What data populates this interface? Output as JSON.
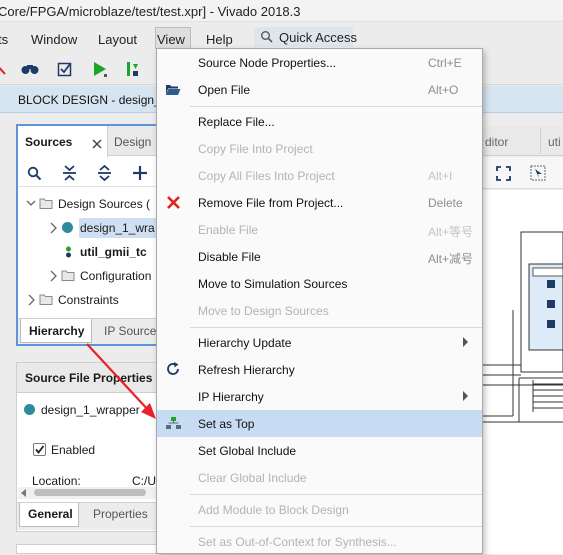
{
  "window": {
    "title": "Core/FPGA/microblaze/test/test.xpr] - Vivado 2018.3"
  },
  "menubar": {
    "items": [
      {
        "label": "ts"
      },
      {
        "label": "Window"
      },
      {
        "label": "Layout"
      },
      {
        "label": "View"
      },
      {
        "label": "Help"
      }
    ],
    "quick_access": "Quick Access"
  },
  "block_design": {
    "title": "BLOCK DESIGN - design_"
  },
  "sources": {
    "tab_active": "Sources",
    "tab_other": "Design",
    "tree": {
      "design_sources": "Design Sources (",
      "design_wrapper": "design_1_wra",
      "util_gmii": "util_gmii_tc",
      "configuration": "Configuration",
      "constraints": "Constraints"
    },
    "bottom_tabs": {
      "hierarchy": "Hierarchy",
      "ip_sources": "IP Source"
    }
  },
  "source_file_properties": {
    "title": "Source File Properties",
    "file": "design_1_wrapper",
    "enabled_label": "Enabled",
    "enabled": true,
    "location_label": "Location:",
    "location_value": "C:/U",
    "tabs": {
      "general": "General",
      "properties": "Properties"
    }
  },
  "right_panel": {
    "tab1": "ditor",
    "tab2": "uti"
  },
  "context_menu": {
    "items": [
      {
        "label": "Source Node Properties...",
        "shortcut": "Ctrl+E",
        "enabled": true
      },
      {
        "label": "Open File",
        "shortcut": "Alt+O",
        "enabled": true
      },
      {
        "label": "Replace File...",
        "shortcut": "",
        "enabled": true
      },
      {
        "label": "Copy File Into Project",
        "shortcut": "",
        "enabled": false
      },
      {
        "label": "Copy All Files Into Project",
        "shortcut": "Alt+I",
        "enabled": false
      },
      {
        "label": "Remove File from Project...",
        "shortcut": "Delete",
        "enabled": true
      },
      {
        "label": "Enable File",
        "shortcut": "Alt+等号",
        "enabled": false
      },
      {
        "label": "Disable File",
        "shortcut": "Alt+减号",
        "enabled": true
      },
      {
        "label": "Move to Simulation Sources",
        "shortcut": "",
        "enabled": true
      },
      {
        "label": "Move to Design Sources",
        "shortcut": "",
        "enabled": false
      },
      {
        "label": "Hierarchy Update",
        "shortcut": "",
        "enabled": true,
        "submenu": true
      },
      {
        "label": "Refresh Hierarchy",
        "shortcut": "",
        "enabled": true
      },
      {
        "label": "IP Hierarchy",
        "shortcut": "",
        "enabled": true,
        "submenu": true
      },
      {
        "label": "Set as Top",
        "shortcut": "",
        "enabled": true,
        "highlighted": true
      },
      {
        "label": "Set Global Include",
        "shortcut": "",
        "enabled": true
      },
      {
        "label": "Clear Global Include",
        "shortcut": "",
        "enabled": false
      },
      {
        "label": "Add Module to Block Design",
        "shortcut": "",
        "enabled": false
      },
      {
        "label": "Set as Out-of-Context for Synthesis...",
        "shortcut": "",
        "enabled": false
      }
    ]
  },
  "colors": {
    "menu_highlight": "#c7dcf3",
    "panel_focus_border": "#5d95d6",
    "annotation_arrow": "#e8202a",
    "remove_icon": "#e22020",
    "run_icon": "#1fa32a"
  }
}
